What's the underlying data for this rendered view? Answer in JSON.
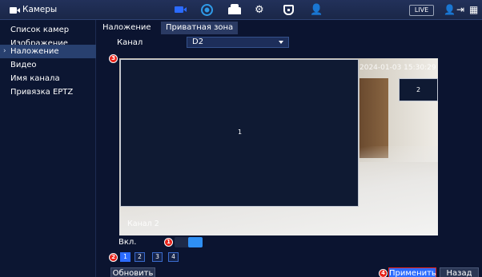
{
  "app": {
    "title": "Камеры",
    "title_icon": "camera-icon"
  },
  "topbar": {
    "icons": [
      "video-icon",
      "network-icon",
      "storage-icon",
      "settings-icon",
      "shield-icon",
      "user-settings-icon"
    ],
    "live_label": "LIVE",
    "right_icons": [
      "user-icon",
      "logout-icon",
      "grid-icon"
    ],
    "settings_glyph": "⚙",
    "user_glyph": "👤",
    "user_right_glyph": "👤",
    "logout_glyph": "⇥",
    "grid_glyph": "▦"
  },
  "sidebar": {
    "items": [
      {
        "label": "Список камер",
        "active": false
      },
      {
        "label": "Изображение",
        "active": false
      },
      {
        "label": "Наложение",
        "active": true,
        "marker": "›"
      },
      {
        "label": "Видео",
        "active": false
      },
      {
        "label": "Имя канала",
        "active": false
      },
      {
        "label": "Привязка EPTZ",
        "active": false
      }
    ]
  },
  "main": {
    "tabs": [
      {
        "label": "Наложение",
        "active": false
      },
      {
        "label": "Приватная зона",
        "active": true
      }
    ],
    "channel": {
      "label": "Канал",
      "value": "D2"
    },
    "preview": {
      "timestamp": "2024-01-03 15:30:29",
      "channel_osd": "Канал 2",
      "masks": [
        {
          "label": "1"
        },
        {
          "label": "2"
        }
      ]
    },
    "enable": {
      "label": "Вкл.",
      "on": true
    },
    "regions": [
      "1",
      "2",
      "3",
      "4"
    ],
    "active_region": "1",
    "badges": {
      "b1": "1",
      "b2": "2",
      "b3": "3",
      "b4": "4"
    },
    "buttons": {
      "refresh": "Обновить",
      "apply": "Применить",
      "back": "Назад"
    }
  },
  "colors": {
    "accent": "#2b6bff",
    "badge": "#e8231a",
    "background": "#0b1430",
    "active_item": "#28406f"
  }
}
